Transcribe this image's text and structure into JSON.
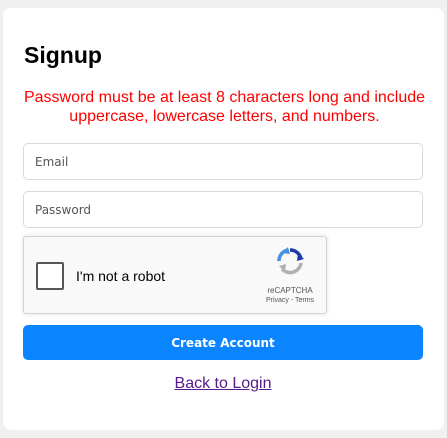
{
  "form": {
    "title": "Signup",
    "password_notice": "Password must be at least 8 characters long and include uppercase, lowercase letters, and numbers.",
    "email_placeholder": "Email",
    "password_placeholder": "Password",
    "submit_label": "Create Account",
    "back_link_label": "Back to Login"
  },
  "recaptcha": {
    "checkbox_label": "I'm not a robot",
    "brand": "reCAPTCHA",
    "privacy_label": "Privacy",
    "separator": " - ",
    "terms_label": "Terms",
    "logo_icon": "recaptcha-logo-icon"
  },
  "colors": {
    "notice": "#ff0000",
    "button": "#0a84ff",
    "link": "#551a8b",
    "background": "#f0f0f0"
  }
}
